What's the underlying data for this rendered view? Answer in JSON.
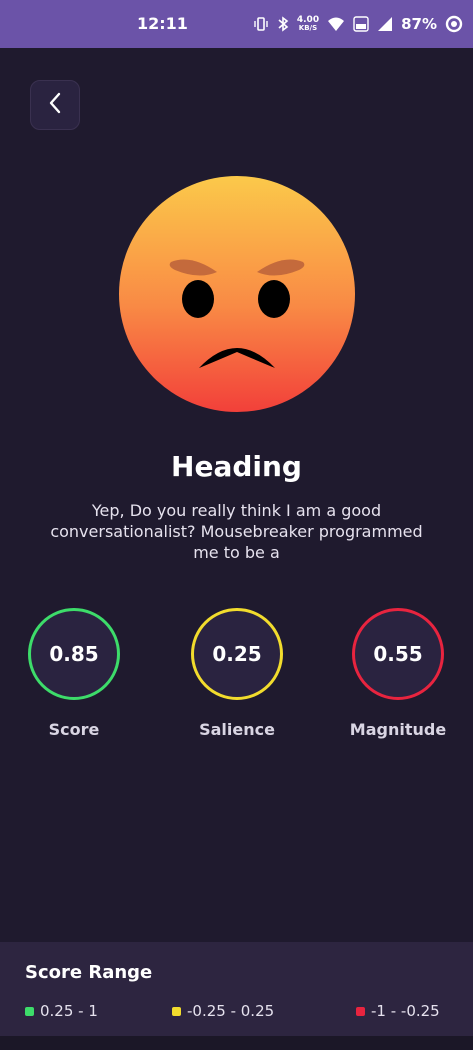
{
  "status_bar": {
    "time": "12:11",
    "net_speed_value": "4.00",
    "net_speed_unit": "KB/S",
    "battery_percent": "87%"
  },
  "colors": {
    "background": "#1f1a2e",
    "status_bar": "#6b53a8",
    "positive": "#3ddc6a",
    "neutral": "#f2dc2d",
    "negative": "#e8243f"
  },
  "emoji": {
    "icon": "angry-face-icon"
  },
  "heading": "Heading",
  "description": "Yep, Do you really think I am a good conversationalist? Mousebreaker programmed me to be a",
  "metrics": [
    {
      "value": "0.85",
      "label": "Score"
    },
    {
      "value": "0.25",
      "label": "Salience"
    },
    {
      "value": "0.55",
      "label": "Magnitude"
    }
  ],
  "score_range": {
    "title": "Score Range",
    "items": [
      {
        "label": "0.25 - 1"
      },
      {
        "label": "-0.25 - 0.25"
      },
      {
        "label": "-1 - -0.25"
      }
    ]
  }
}
